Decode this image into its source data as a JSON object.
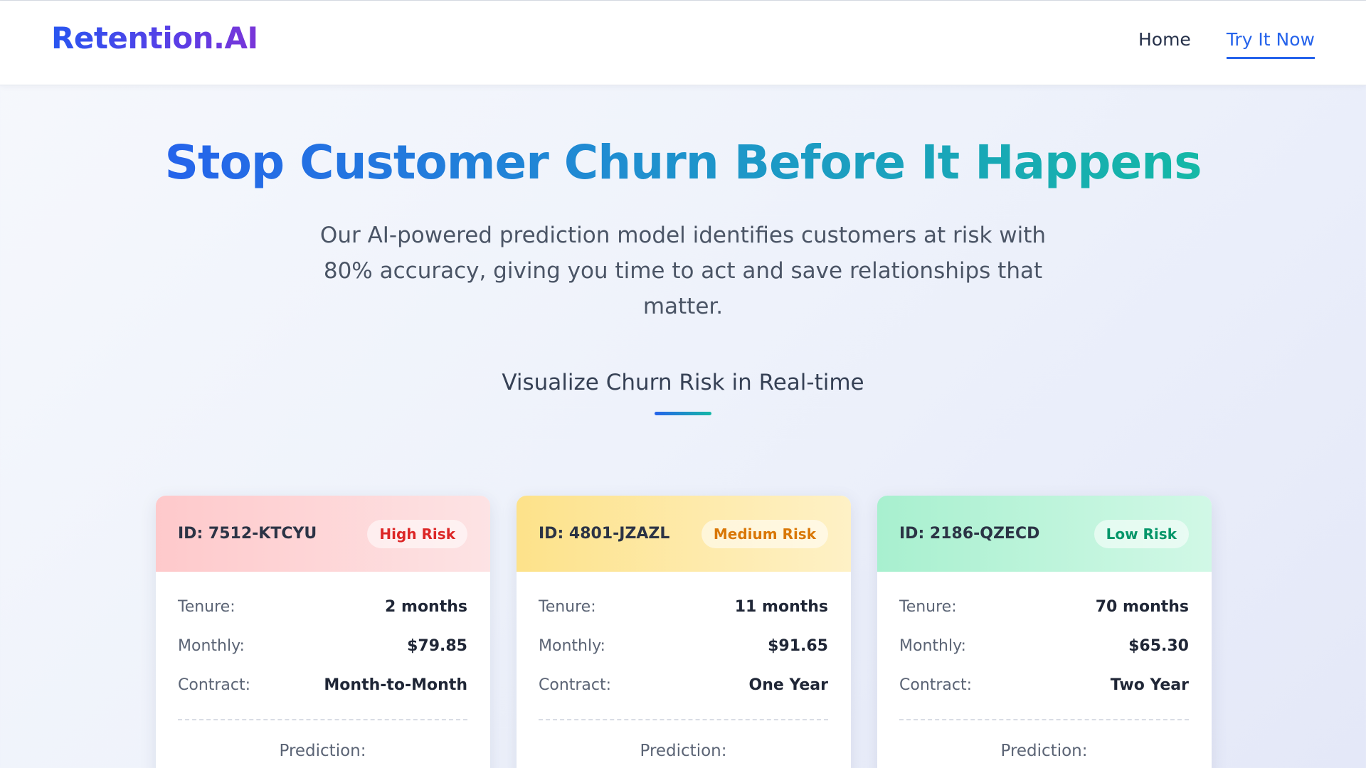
{
  "brand": {
    "logo": "Retention.AI"
  },
  "nav": {
    "items": [
      {
        "label": "Home",
        "active": false
      },
      {
        "label": "Try It Now",
        "active": true
      }
    ]
  },
  "hero": {
    "title": "Stop Customer Churn Before It Happens",
    "subtitle": "Our AI-powered prediction model identifies customers at risk with 80% accuracy, giving you time to act and save relationships that matter."
  },
  "section": {
    "title": "Visualize Churn Risk in Real-time"
  },
  "labels": {
    "tenure": "Tenure:",
    "monthly": "Monthly:",
    "contract": "Contract:",
    "prediction": "Prediction:"
  },
  "cards": [
    {
      "id": "ID: 7512-KTCYU",
      "risk": "High Risk",
      "tenure": "2 months",
      "monthly": "$79.85",
      "contract": "Month-to-Month"
    },
    {
      "id": "ID: 4801-JZAZL",
      "risk": "Medium Risk",
      "tenure": "11 months",
      "monthly": "$91.65",
      "contract": "One Year"
    },
    {
      "id": "ID: 2186-QZECD",
      "risk": "Low Risk",
      "tenure": "70 months",
      "monthly": "$65.30",
      "contract": "Two Year"
    }
  ],
  "colors": {
    "accent": "#2563eb",
    "teal": "#14b8a6",
    "high": "#dc2626",
    "medium": "#d97706",
    "low": "#059669"
  }
}
